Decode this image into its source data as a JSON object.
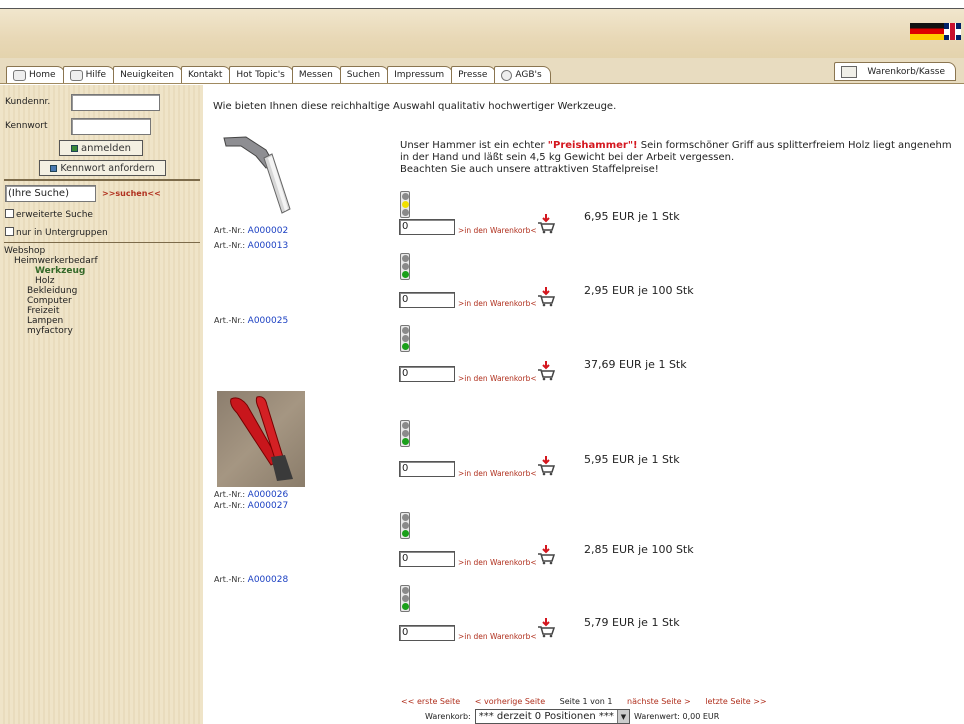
{
  "nav": {
    "tabs": [
      "Home",
      "Hilfe",
      "Neuigkeiten",
      "Kontakt",
      "Hot Topic's",
      "Messen",
      "Suchen",
      "Impressum",
      "Presse",
      "AGB's"
    ],
    "cart": "Warenkorb/Kasse"
  },
  "sidebar": {
    "customer_label": "Kundennr.",
    "password_label": "Kennwort",
    "login_button": "anmelden",
    "request_password_button": "Kennwort anfordern",
    "search_placeholder": "(Ihre Suche)",
    "search_link": ">>suchen<<",
    "advanced_search": "erweiterte Suche",
    "subgroups": "nur in Untergruppen",
    "tree": [
      {
        "label": "Webshop",
        "level": 0,
        "active": false
      },
      {
        "label": "Heimwerkerbedarf",
        "level": 1,
        "active": false
      },
      {
        "label": "Werkzeug",
        "level": 2,
        "active": true
      },
      {
        "label": "Holz",
        "level": 2,
        "active": false
      },
      {
        "label": "Bekleidung",
        "level": 1,
        "active": false
      },
      {
        "label": "Computer",
        "level": 1,
        "active": false
      },
      {
        "label": "Freizeit",
        "level": 1,
        "active": false
      },
      {
        "label": "Lampen",
        "level": 1,
        "active": false
      },
      {
        "label": "myfactory",
        "level": 1,
        "active": false
      }
    ]
  },
  "main": {
    "intro": "Wie bieten Ihnen diese reichhaltige Auswahl qualitativ hochwertiger Werkzeuge.",
    "description": {
      "before": "Unser Hammer ist ein echter ",
      "highlight": "\"Preishammer\"!",
      "after": " Sein formschöner Griff aus splitterfreiem Holz liegt angenehm in der Hand und läßt sein 4,5 kg Gewicht bei der Arbeit vergessen.",
      "line2": "Beachten Sie auch unsere attraktiven Staffelpreise!"
    },
    "art_prefix": "Art.-Nr.:",
    "articles": [
      "A000002",
      "A000013",
      "A000025",
      "A000026",
      "A000027",
      "A000028"
    ],
    "add_label": ">in den Warenkorb<",
    "items": [
      {
        "qty": "0",
        "price": "6,95 EUR je 1 Stk",
        "light": "yellow"
      },
      {
        "qty": "0",
        "price": "2,95 EUR je 100 Stk",
        "light": "green"
      },
      {
        "qty": "0",
        "price": "37,69 EUR je 1 Stk",
        "light": "green"
      },
      {
        "qty": "0",
        "price": "5,95 EUR je 1 Stk",
        "light": "green"
      },
      {
        "qty": "0",
        "price": "2,85 EUR je 100 Stk",
        "light": "green"
      },
      {
        "qty": "0",
        "price": "5,79 EUR je 1 Stk",
        "light": "green"
      }
    ]
  },
  "pager": {
    "first": "<< erste Seite",
    "prev": "< vorherige Seite",
    "current": "Seite 1 von 1",
    "next": "nächste Seite >",
    "last": "letzte Seite >>"
  },
  "footer": {
    "cart_label": "Warenkorb:",
    "cart_value": "*** derzeit 0 Positionen ***",
    "value_label": "Warenwert: 0,00 EUR"
  },
  "colors": {
    "accent_red": "#d4161e",
    "link_blue": "#1a3fc2",
    "sidebar_bg": "#ece0c3"
  }
}
